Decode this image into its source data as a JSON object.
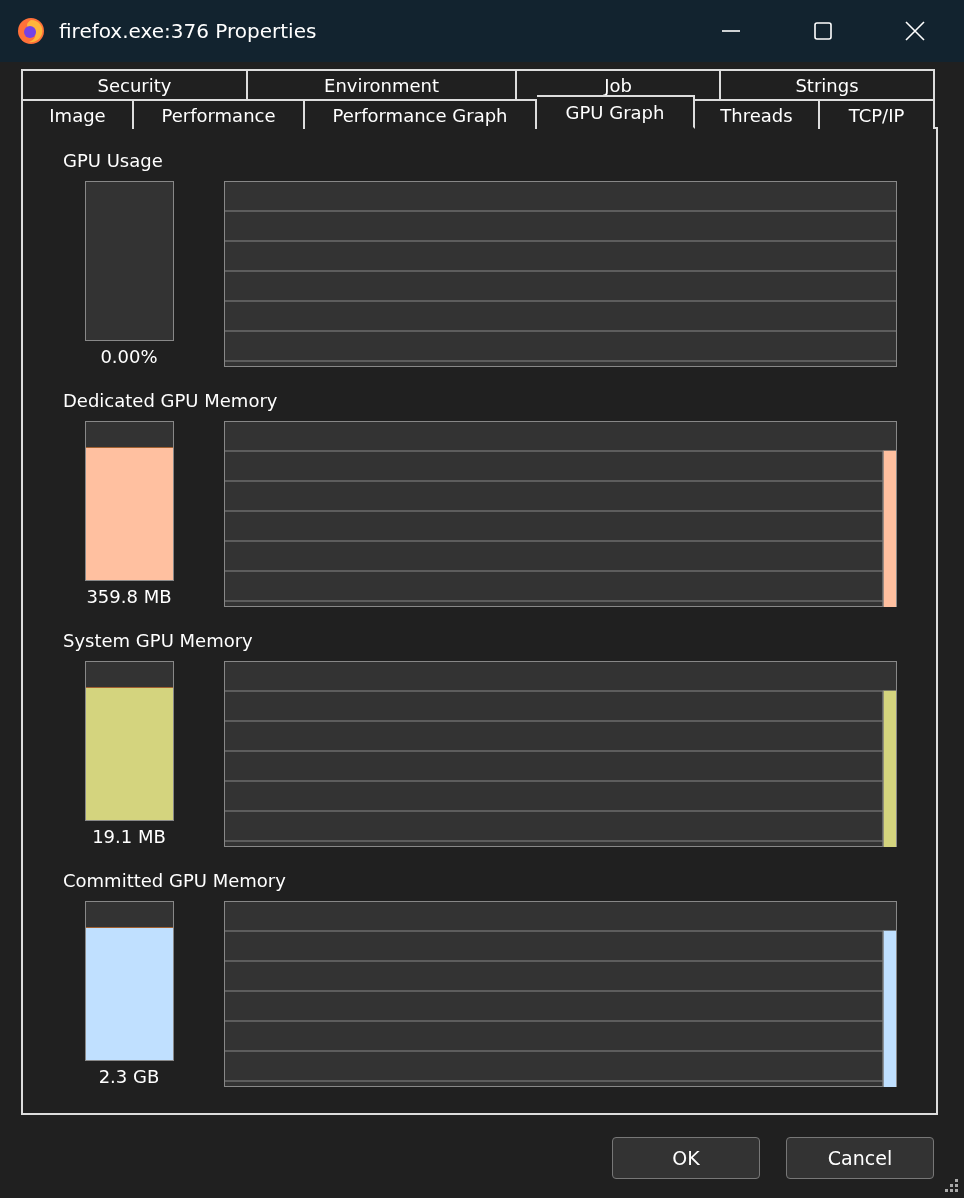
{
  "window": {
    "title": "firefox.exe:376 Properties"
  },
  "tab_rows": [
    [
      {
        "label": "Security",
        "selected": false
      },
      {
        "label": "Environment",
        "selected": false
      },
      {
        "label": "Job",
        "selected": false
      },
      {
        "label": "Strings",
        "selected": false
      }
    ],
    [
      {
        "label": "Image",
        "selected": false
      },
      {
        "label": "Performance",
        "selected": false
      },
      {
        "label": "Performance Graph",
        "selected": false
      },
      {
        "label": "GPU Graph",
        "selected": true
      },
      {
        "label": "Threads",
        "selected": false
      },
      {
        "label": "TCP/IP",
        "selected": false
      }
    ]
  ],
  "sections": [
    {
      "title": "GPU Usage",
      "reading": "0.00%",
      "level": 0
    },
    {
      "title": "Dedicated GPU Memory",
      "reading": "359.8 MB",
      "level": 0.84,
      "color": "#ffc0a0"
    },
    {
      "title": "System GPU Memory",
      "reading": "19.1 MB",
      "level": 0.84,
      "color": "#d4d47e"
    },
    {
      "title": "Committed GPU Memory",
      "reading": "2.3 GB",
      "level": 0.84,
      "color": "#c0e0ff"
    }
  ],
  "buttons": [
    "OK",
    "Cancel"
  ]
}
